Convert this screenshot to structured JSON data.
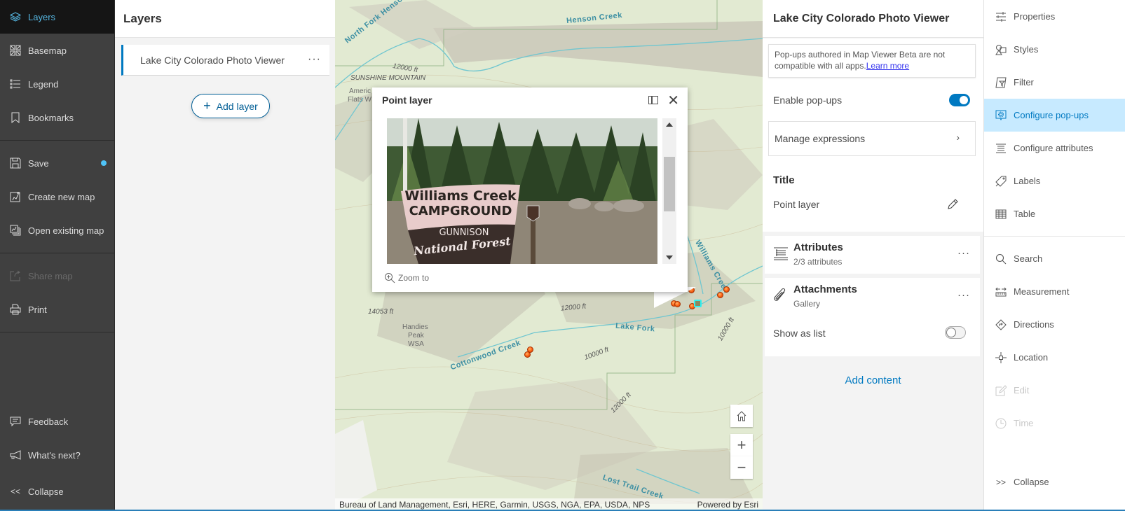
{
  "leftnav": {
    "items": [
      {
        "label": "Layers",
        "icon": "layers-icon",
        "active": true
      },
      {
        "label": "Basemap",
        "icon": "basemap-icon"
      },
      {
        "label": "Legend",
        "icon": "legend-icon"
      },
      {
        "label": "Bookmarks",
        "icon": "bookmark-icon"
      }
    ],
    "items2": [
      {
        "label": "Save",
        "icon": "save-icon",
        "unsaved": true
      },
      {
        "label": "Create new map",
        "icon": "new-map-icon"
      },
      {
        "label": "Open existing map",
        "icon": "open-map-icon"
      }
    ],
    "items3": [
      {
        "label": "Share map",
        "icon": "share-icon",
        "disabled": true
      },
      {
        "label": "Print",
        "icon": "print-icon"
      }
    ],
    "bottom": [
      {
        "label": "Feedback",
        "icon": "feedback-icon"
      },
      {
        "label": "What's next?",
        "icon": "megaphone-icon"
      },
      {
        "label": "Collapse",
        "icon": "collapse-left-icon"
      }
    ],
    "accent_color": "#56b7e3"
  },
  "layers_panel": {
    "title": "Layers",
    "layer_name": "Lake City Colorado Photo Viewer",
    "more_label": "···",
    "add_layer_label": "Add layer"
  },
  "map": {
    "labels": {
      "north_fork": "North Fork Henson Creek",
      "henson": "Henson Creek",
      "sunshine": "SUNSHINE MOUNTAIN",
      "american_flats_1": "Americ",
      "american_flats_2": "Flats W",
      "elev_12000_a": "12000 ft",
      "elev_14053": "14053 ft",
      "handies_1": "Handies",
      "handies_2": "Peak",
      "handies_3": "WSA",
      "cottonwood": "Cottonwood Creek",
      "lake_fork": "Lake Fork",
      "elev_10000_a": "10000 ft",
      "elev_12000_b": "12000 ft",
      "elev_12000_c": "12000 ft",
      "elev_10000_b": "10000 ft",
      "williams": "Williams Creek",
      "lost_trail": "Lost Trail Creek"
    },
    "attribution": "Bureau of Land Management, Esri, HERE, Garmin, USGS, NGA, EPA, USDA, NPS",
    "powered_by": "Powered by Esri",
    "popup": {
      "title": "Point layer",
      "photo_sign_line1": "Williams Creek",
      "photo_sign_line2": "CAMPGROUND",
      "photo_sign_line3": "GUNNISON",
      "photo_sign_line4": "National Forest",
      "zoom_to_label": "Zoom to"
    }
  },
  "config_panel": {
    "title": "Lake City Colorado Photo Viewer",
    "notice_text": "Pop-ups authored in Map Viewer Beta are not compatible with all apps.",
    "notice_link": "Learn more",
    "enable_popups_label": "Enable pop-ups",
    "enable_popups": true,
    "manage_expressions_label": "Manage expressions",
    "title_section_label": "Title",
    "title_value": "Point layer",
    "attributes_title": "Attributes",
    "attributes_sub": "2/3 attributes",
    "attachments_title": "Attachments",
    "attachments_sub": "Gallery",
    "show_as_list_label": "Show as list",
    "show_as_list": false,
    "add_content_label": "Add content"
  },
  "tools": {
    "items": [
      {
        "label": "Properties",
        "icon": "properties-icon"
      },
      {
        "label": "Styles",
        "icon": "styles-icon"
      },
      {
        "label": "Filter",
        "icon": "filter-icon"
      },
      {
        "label": "Configure pop-ups",
        "icon": "configure-popups-icon",
        "active": true
      },
      {
        "label": "Configure attributes",
        "icon": "configure-attributes-icon"
      },
      {
        "label": "Labels",
        "icon": "labels-icon"
      },
      {
        "label": "Table",
        "icon": "table-icon"
      }
    ],
    "items2": [
      {
        "label": "Search",
        "icon": "search-icon"
      },
      {
        "label": "Measurement",
        "icon": "measurement-icon"
      },
      {
        "label": "Directions",
        "icon": "directions-icon"
      },
      {
        "label": "Location",
        "icon": "location-icon"
      },
      {
        "label": "Edit",
        "icon": "edit-icon",
        "disabled": true
      },
      {
        "label": "Time",
        "icon": "time-icon",
        "disabled": true
      }
    ],
    "collapse_label": "Collapse",
    "active_bg": "#c7eaff"
  }
}
